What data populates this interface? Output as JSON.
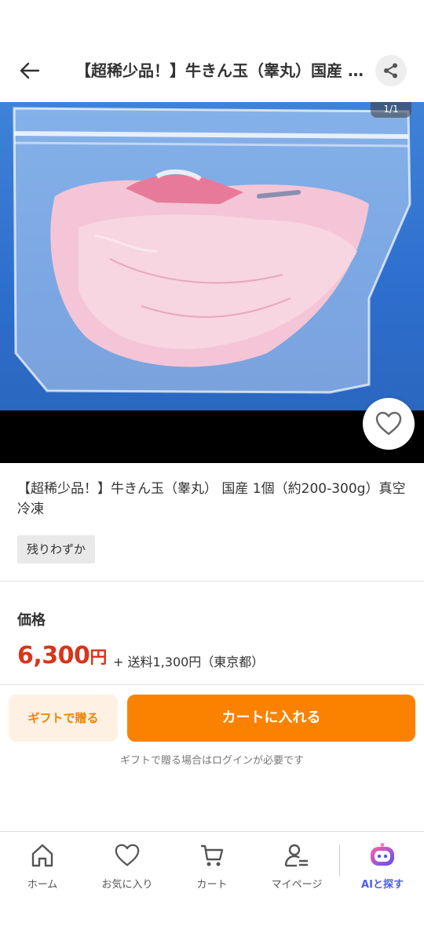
{
  "header": {
    "title": "【超稀少品！】牛きん玉（睾丸）国産 1個（約200-300g）真空冷凍",
    "back_icon": "arrow-left-icon",
    "share_icon": "share-icon"
  },
  "gallery": {
    "counter": "1/1",
    "favorite_icon": "heart-icon"
  },
  "product": {
    "name": "【超稀少品！】牛きん玉（睾丸） 国産 1個（約200-300g）真空冷凍",
    "badge": "残りわずか"
  },
  "price": {
    "label": "価格",
    "amount": "6,300",
    "unit": "円",
    "shipping": "+ 送料1,300円（東京都）"
  },
  "actions": {
    "gift_label": "ギフトで贈る",
    "cart_label": "カートに入れる",
    "gift_note": "ギフトで贈る場合はログインが必要です"
  },
  "nav": {
    "home": "ホーム",
    "favorites": "お気に入り",
    "cart": "カート",
    "mypage": "マイページ",
    "ai_search": "AIと探す"
  },
  "colors": {
    "accent": "#fb8200",
    "price": "#d9341c",
    "ai": "#4a5de8"
  }
}
